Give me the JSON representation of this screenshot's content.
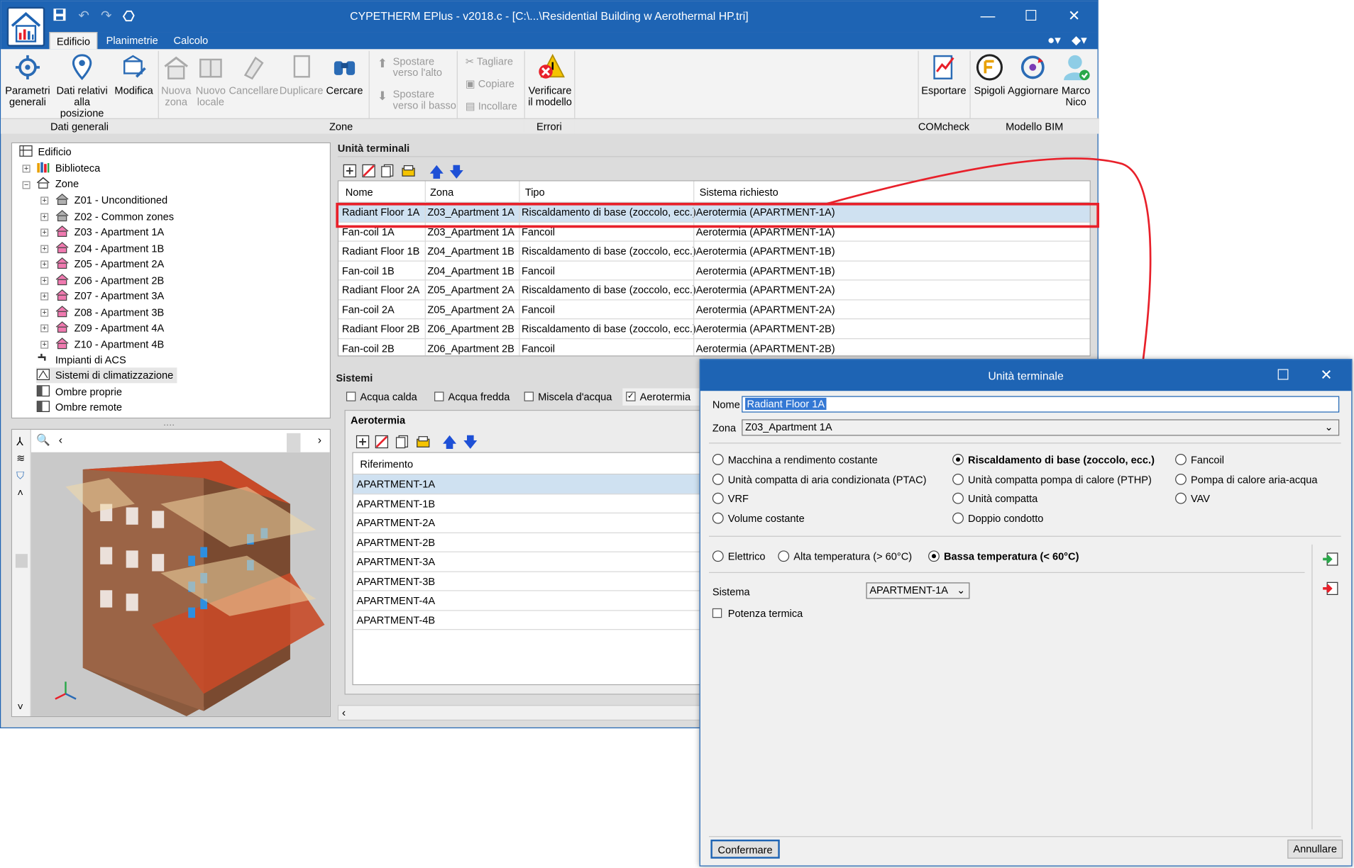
{
  "window": {
    "title": "CYPETHERM EPlus - v2018.c - [C:\\...\\Residential Building w Aerothermal HP.tri]"
  },
  "ribbon": {
    "tabs": [
      "Edificio",
      "Planimetrie",
      "Calcolo"
    ],
    "active_tab": "Edificio",
    "buttons": {
      "parametri": [
        "Parametri",
        "generali"
      ],
      "dati_posizione": [
        "Dati relativi",
        "alla posizione"
      ],
      "modifica": "Modifica",
      "nuova_zona": [
        "Nuova",
        "zona"
      ],
      "nuovo_locale": [
        "Nuovo",
        "locale"
      ],
      "cancellare": "Cancellare",
      "duplicare": "Duplicare",
      "cercare": "Cercare",
      "spostare_alto": [
        "Spostare",
        "verso l'alto"
      ],
      "spostare_basso": [
        "Spostare",
        "verso il basso"
      ],
      "tagliare": "Tagliare",
      "copiare": "Copiare",
      "incollare": "Incollare",
      "verificare": [
        "Verificare",
        "il modello"
      ],
      "esportare": "Esportare",
      "spigoli": "Spigoli",
      "aggiornare": "Aggiornare",
      "user": [
        "Marco",
        "Nico"
      ]
    },
    "groups": {
      "dati_generali": "Dati generali",
      "zone": "Zone",
      "errori": "Errori",
      "comcheck": "COMcheck",
      "modello_bim": "Modello BIM"
    }
  },
  "tree": {
    "root": "Edificio",
    "biblioteca": "Biblioteca",
    "zone_label": "Zone",
    "zones": [
      "Z01 - Unconditioned",
      "Z02 - Common zones",
      "Z03 - Apartment 1A",
      "Z04 - Apartment 1B",
      "Z05 - Apartment 2A",
      "Z06 - Apartment 2B",
      "Z07 - Apartment 3A",
      "Z08 - Apartment 3B",
      "Z09 - Apartment 4A",
      "Z10 - Apartment 4B"
    ],
    "others": [
      "Impianti di ACS",
      "Sistemi di climatizzazione",
      "Ombre proprie",
      "Ombre remote"
    ]
  },
  "terminal_units": {
    "title": "Unità terminali",
    "columns": [
      "Nome",
      "Zona",
      "Tipo",
      "Sistema richiesto"
    ],
    "rows": [
      [
        "Radiant Floor 1A",
        "Z03_Apartment 1A",
        "Riscaldamento di base (zoccolo, ecc.)",
        "Aerotermia (APARTMENT-1A)"
      ],
      [
        "Fan-coil 1A",
        "Z03_Apartment 1A",
        "Fancoil",
        "Aerotermia (APARTMENT-1A)"
      ],
      [
        "Radiant Floor 1B",
        "Z04_Apartment 1B",
        "Riscaldamento di base (zoccolo, ecc.)",
        "Aerotermia (APARTMENT-1B)"
      ],
      [
        "Fan-coil 1B",
        "Z04_Apartment 1B",
        "Fancoil",
        "Aerotermia (APARTMENT-1B)"
      ],
      [
        "Radiant Floor 2A",
        "Z05_Apartment 2A",
        "Riscaldamento di base (zoccolo, ecc.)",
        "Aerotermia (APARTMENT-2A)"
      ],
      [
        "Fan-coil 2A",
        "Z05_Apartment 2A",
        "Fancoil",
        "Aerotermia (APARTMENT-2A)"
      ],
      [
        "Radiant Floor 2B",
        "Z06_Apartment 2B",
        "Riscaldamento di base (zoccolo, ecc.)",
        "Aerotermia (APARTMENT-2B)"
      ],
      [
        "Fan-coil 2B",
        "Z06_Apartment 2B",
        "Fancoil",
        "Aerotermia (APARTMENT-2B)"
      ]
    ]
  },
  "systems": {
    "title": "Sistemi",
    "tabs": [
      {
        "label": "Acqua calda",
        "checked": false
      },
      {
        "label": "Acqua fredda",
        "checked": false
      },
      {
        "label": "Miscela d'acqua",
        "checked": false
      },
      {
        "label": "Aerotermia",
        "checked": true
      }
    ],
    "panel_title": "Aerotermia",
    "ref_header": "Riferimento",
    "refs": [
      "APARTMENT-1A",
      "APARTMENT-1B",
      "APARTMENT-2A",
      "APARTMENT-2B",
      "APARTMENT-3A",
      "APARTMENT-3B",
      "APARTMENT-4A",
      "APARTMENT-4B"
    ]
  },
  "dialog": {
    "title": "Unità terminale",
    "nome_label": "Nome",
    "nome_value": "Radiant Floor 1A",
    "zona_label": "Zona",
    "zona_value": "Z03_Apartment 1A",
    "types": [
      {
        "label": "Macchina a rendimento costante",
        "selected": false
      },
      {
        "label": "Riscaldamento di base (zoccolo, ecc.)",
        "selected": true
      },
      {
        "label": "Fancoil",
        "selected": false
      },
      {
        "label": "Unità compatta di aria condizionata (PTAC)",
        "selected": false
      },
      {
        "label": "Unità compatta pompa di calore (PTHP)",
        "selected": false
      },
      {
        "label": "Pompa di calore aria-acqua",
        "selected": false
      },
      {
        "label": "VRF",
        "selected": false
      },
      {
        "label": "Unità compatta",
        "selected": false
      },
      {
        "label": "VAV",
        "selected": false
      },
      {
        "label": "Volume costante",
        "selected": false
      },
      {
        "label": "Doppio condotto",
        "selected": false
      }
    ],
    "heating": [
      {
        "label": "Elettrico",
        "selected": false
      },
      {
        "label": "Alta temperatura (> 60°C)",
        "selected": false
      },
      {
        "label": "Bassa temperatura (< 60°C)",
        "selected": true
      }
    ],
    "sistema_label": "Sistema",
    "sistema_value": "APARTMENT-1A",
    "potenza_label": "Potenza termica",
    "potenza_checked": false,
    "confirm": "Confermare",
    "cancel": "Annullare"
  },
  "colors": {
    "title_blue": "#1e64b4",
    "selection": "#cfe1f1",
    "highlight_red": "#e8202a"
  }
}
